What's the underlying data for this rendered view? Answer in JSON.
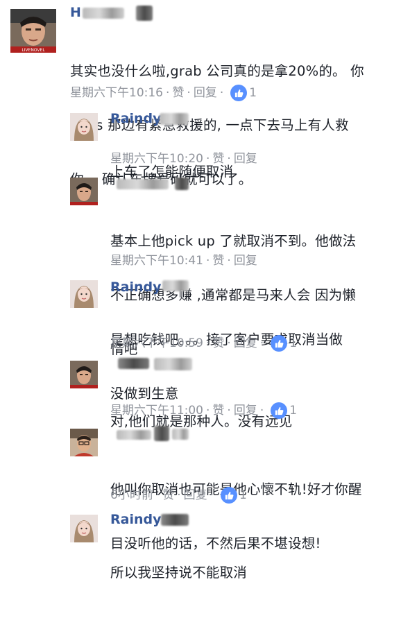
{
  "comments": [
    {
      "id": "c1",
      "level": 0,
      "author": "H",
      "author_redacted": true,
      "avatar": "male-avatar-1",
      "avatar_badge": "LIVENOVEL",
      "lines": [
        "其实也没什么啦,grab 公司真的是拿20%的。 你",
        "apps 那边有紧急救援的, 一点下去马上有人救",
        "你。 确认车牌号码就可以了。"
      ],
      "time": "星期六下午10:16",
      "like_label": "赞",
      "reply_label": "回复",
      "like_count": "1"
    },
    {
      "id": "c2",
      "level": 1,
      "author": "Raindy",
      "author_redacted": true,
      "avatar": "female-avatar",
      "lines": [
        "上车了怎能随便取消"
      ],
      "time": "星期六下午10:20",
      "like_label": "赞",
      "reply_label": "回复",
      "like_count": ""
    },
    {
      "id": "c3",
      "level": 1,
      "author": "",
      "author_redacted": true,
      "avatar": "male-avatar-1",
      "lines": [
        "基本上他pick up 了就取消不到。他做法",
        "不正确想多赚 ,通常都是马来人会 因为懒",
        "惰吧"
      ],
      "time": "星期六下午10:41",
      "like_label": "赞",
      "reply_label": "回复",
      "like_count": ""
    },
    {
      "id": "c4",
      "level": 1,
      "author": "Raindy",
      "author_redacted": true,
      "avatar": "female-avatar",
      "lines": [
        "是想吃钱吧。。。接了客户要求取消当做",
        "没做到生意"
      ],
      "time": "星期六下午10:59",
      "like_label": "赞",
      "reply_label": "回复",
      "like_count": "1"
    },
    {
      "id": "c5",
      "level": 1,
      "author": "",
      "author_redacted": true,
      "avatar": "male-avatar-1",
      "lines": [
        "对,他们就是那种人。没有远见"
      ],
      "time": "星期六下午11:00",
      "like_label": "赞",
      "reply_label": "回复",
      "like_count": "1"
    },
    {
      "id": "c6",
      "level": 1,
      "author": "",
      "author_redacted": true,
      "avatar": "male-avatar-2",
      "lines": [
        "他叫你取消也可能是他心懷不轨!好才你醒",
        "目没听他的话，不然后果不堪设想!"
      ],
      "time": "6小时前",
      "like_label": "赞",
      "reply_label": "回复",
      "like_count": "1"
    },
    {
      "id": "c7",
      "level": 1,
      "author": "Raindy",
      "author_redacted": true,
      "avatar": "female-avatar",
      "lines": [
        "所以我坚持说不能取消"
      ],
      "time": "",
      "like_label": "",
      "reply_label": "",
      "like_count": ""
    }
  ],
  "colors": {
    "name": "#365899",
    "text": "#1d2129",
    "meta": "#90949c",
    "like_badge": "#5890ff"
  }
}
